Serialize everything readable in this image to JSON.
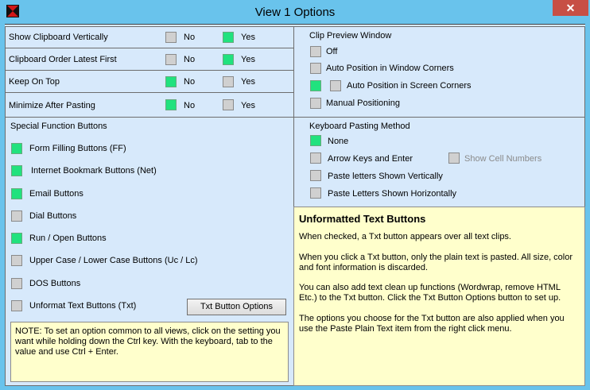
{
  "window": {
    "title": "View 1 Options",
    "close_label": "✕"
  },
  "toggles": [
    {
      "label": "Show Clipboard Vertically",
      "no": "No",
      "yes": "Yes",
      "selected": "yes"
    },
    {
      "label": "Clipboard Order Latest First",
      "no": "No",
      "yes": "Yes",
      "selected": "yes"
    },
    {
      "label": "Keep On Top",
      "no": "No",
      "yes": "Yes",
      "selected": "no"
    },
    {
      "label": "Minimize After Pasting",
      "no": "No",
      "yes": "Yes",
      "selected": "no"
    }
  ],
  "special": {
    "title": "Special Function Buttons",
    "items": [
      {
        "label": "Form Filling Buttons (FF)",
        "checked": true
      },
      {
        "label": "Internet Bookmark Buttons (Net)",
        "checked": true
      },
      {
        "label": "Email Buttons",
        "checked": true
      },
      {
        "label": "Dial Buttons",
        "checked": false
      },
      {
        "label": "Run / Open Buttons",
        "checked": true
      },
      {
        "label": "Upper Case / Lower Case Buttons (Uc / Lc)",
        "checked": false
      },
      {
        "label": "DOS Buttons",
        "checked": false
      },
      {
        "label": "Unformat Text Buttons (Txt)",
        "checked": false
      }
    ],
    "txt_options_button": "Txt Button Options"
  },
  "note": "NOTE:  To set an option common to all views, click on the setting you want while holding down the Ctrl key. With the keyboard, tab to the value and use Ctrl + Enter.",
  "clip_preview": {
    "title": "Clip Preview Window",
    "options": [
      {
        "label": "Off",
        "checked": false
      },
      {
        "label": "Auto Position in Window Corners",
        "checked": false
      },
      {
        "label": "Auto Position in Screen Corners",
        "checked": true
      },
      {
        "label": "Manual Positioning",
        "checked": false
      }
    ]
  },
  "keyboard": {
    "title": "Keyboard Pasting Method",
    "options": [
      {
        "label": "None",
        "checked": true
      },
      {
        "label": "Arrow Keys and Enter",
        "checked": false
      },
      {
        "label": "Paste letters Shown Vertically",
        "checked": false
      },
      {
        "label": "Paste Letters Shown Horizontally",
        "checked": false
      }
    ],
    "show_cell_numbers": "Show Cell Numbers"
  },
  "info": {
    "title": "Unformatted Text Buttons",
    "paragraphs": [
      "When checked, a Txt button appears over all text clips.",
      "When you click a Txt button, only the plain text is pasted. All size, color and font information is discarded.",
      "You can also add text clean up functions (Wordwrap, remove HTML Etc.) to the Txt button. Click the Txt Button Options button to set up.",
      "The options you choose for the Txt button are also applied when you use the Paste Plain Text item from the right click menu."
    ]
  },
  "colors": {
    "checked": "#21e27e",
    "unchecked": "#d0d0d0",
    "info_bg": "#ffffcc",
    "panel_bg": "#d7e9fb",
    "frame": "#69c3ec"
  }
}
